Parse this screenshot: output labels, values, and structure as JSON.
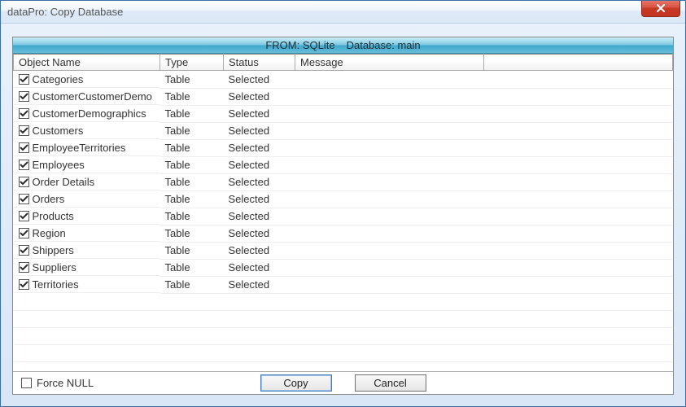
{
  "window": {
    "title": "dataPro: Copy Database"
  },
  "fromBar": {
    "from": "FROM: SQLite",
    "database": "Database: main"
  },
  "columns": {
    "name": "Object Name",
    "type": "Type",
    "status": "Status",
    "message": "Message",
    "extra": ""
  },
  "rows": [
    {
      "checked": true,
      "name": "Categories",
      "type": "Table",
      "status": "Selected",
      "message": ""
    },
    {
      "checked": true,
      "name": "CustomerCustomerDemo",
      "type": "Table",
      "status": "Selected",
      "message": ""
    },
    {
      "checked": true,
      "name": "CustomerDemographics",
      "type": "Table",
      "status": "Selected",
      "message": ""
    },
    {
      "checked": true,
      "name": "Customers",
      "type": "Table",
      "status": "Selected",
      "message": ""
    },
    {
      "checked": true,
      "name": "EmployeeTerritories",
      "type": "Table",
      "status": "Selected",
      "message": ""
    },
    {
      "checked": true,
      "name": "Employees",
      "type": "Table",
      "status": "Selected",
      "message": ""
    },
    {
      "checked": true,
      "name": "Order Details",
      "type": "Table",
      "status": "Selected",
      "message": ""
    },
    {
      "checked": true,
      "name": "Orders",
      "type": "Table",
      "status": "Selected",
      "message": ""
    },
    {
      "checked": true,
      "name": "Products",
      "type": "Table",
      "status": "Selected",
      "message": ""
    },
    {
      "checked": true,
      "name": "Region",
      "type": "Table",
      "status": "Selected",
      "message": ""
    },
    {
      "checked": true,
      "name": "Shippers",
      "type": "Table",
      "status": "Selected",
      "message": ""
    },
    {
      "checked": true,
      "name": "Suppliers",
      "type": "Table",
      "status": "Selected",
      "message": ""
    },
    {
      "checked": true,
      "name": "Territories",
      "type": "Table",
      "status": "Selected",
      "message": ""
    }
  ],
  "emptyRows": 4,
  "footer": {
    "forceNull": {
      "label": "Force NULL",
      "checked": false
    },
    "copy": "Copy",
    "cancel": "Cancel"
  }
}
